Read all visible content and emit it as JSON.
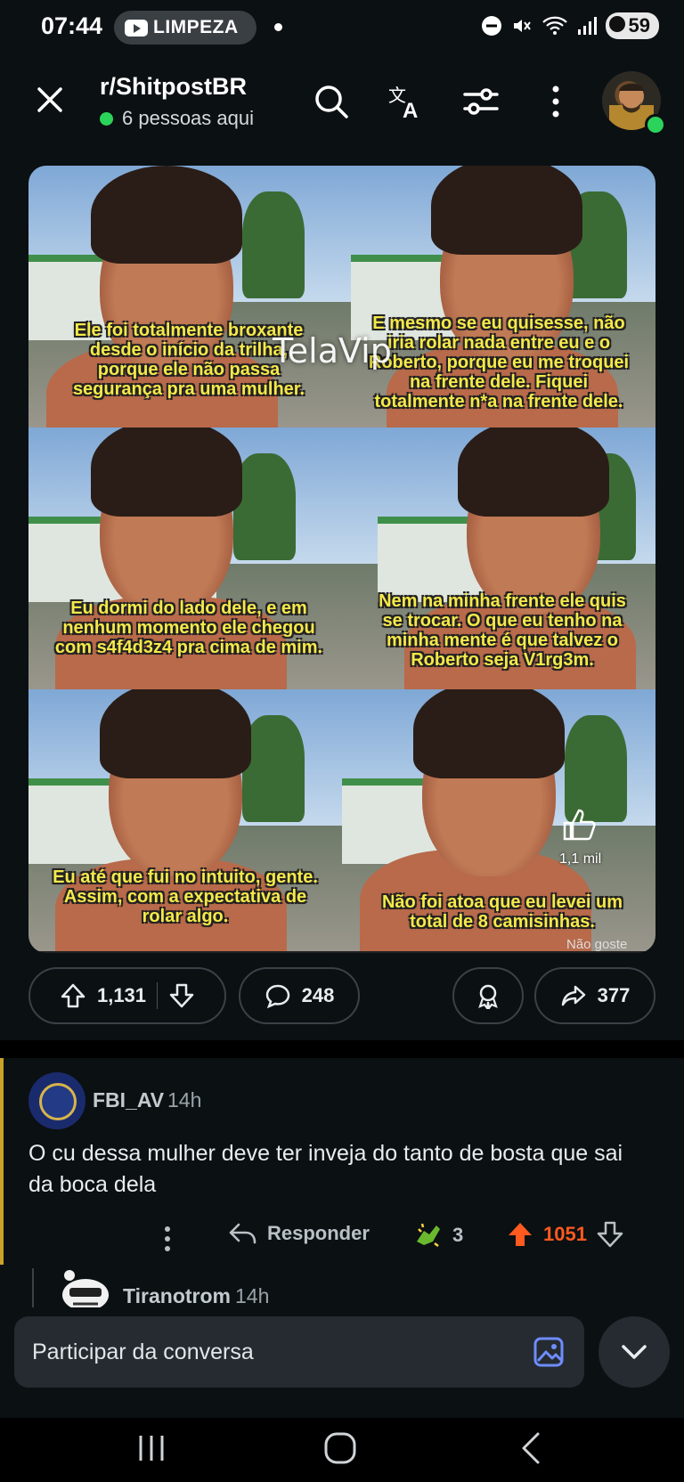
{
  "status_bar": {
    "time": "07:44",
    "media_pill_label": "LIMPEZA",
    "battery": "59",
    "icons": [
      "minus-circle-icon",
      "mute-icon",
      "wifi-icon",
      "signal-icon",
      "battery-icon"
    ]
  },
  "header": {
    "subreddit": "r/ShitpostBR",
    "online_text": "6 pessoas aqui",
    "icons": [
      "close-icon",
      "search-icon",
      "translate-icon",
      "filter-icon",
      "more-icon",
      "avatar"
    ]
  },
  "post": {
    "watermark": "TelaVip",
    "captions": [
      "Ele foi totalmente broxante\ndesde o início da trilha,\nporque ele não passa\nsegurança pra uma mulher.",
      "E mesmo se eu quisesse, não\niria rolar nada entre eu e o\nRoberto, porque eu me troquei\nna frente dele. Fiquei\ntotalmente n*a na frente dele.",
      "Eu dormi do lado dele, e em\nnenhum momento ele chegou\ncom s4f4d3z4 pra cima de mim.",
      "Nem na minha frente ele quis\nse trocar. O que eu tenho na\nminha mente é que talvez o\nRoberto seja V1rg3m.",
      "Eu até que fui no intuito, gente.\nAssim, com a expectativa de\nrolar algo.",
      "Não foi atoa que eu levei um\ntotal de 8 camisinhas."
    ],
    "overlay_like_count": "1,1 mil",
    "overlay_dislike_label": "Não goste",
    "upvotes": "1,131",
    "comments": "248",
    "shares": "377"
  },
  "comment": {
    "username": "FBI_AV",
    "time": "14h",
    "text": "O cu dessa mulher deve ter inveja do tanto de bosta que sai da boca dela",
    "reply_label": "Responder",
    "award_count": "3",
    "score": "1051",
    "accent_color": "#c9a227"
  },
  "reply": {
    "username": "Tiranotrom",
    "time": "14h"
  },
  "composer": {
    "placeholder": "Participar da conversa"
  },
  "colors": {
    "background": "#0b1013",
    "upvote_active": "#ff5a1f",
    "online": "#2bd35a"
  }
}
